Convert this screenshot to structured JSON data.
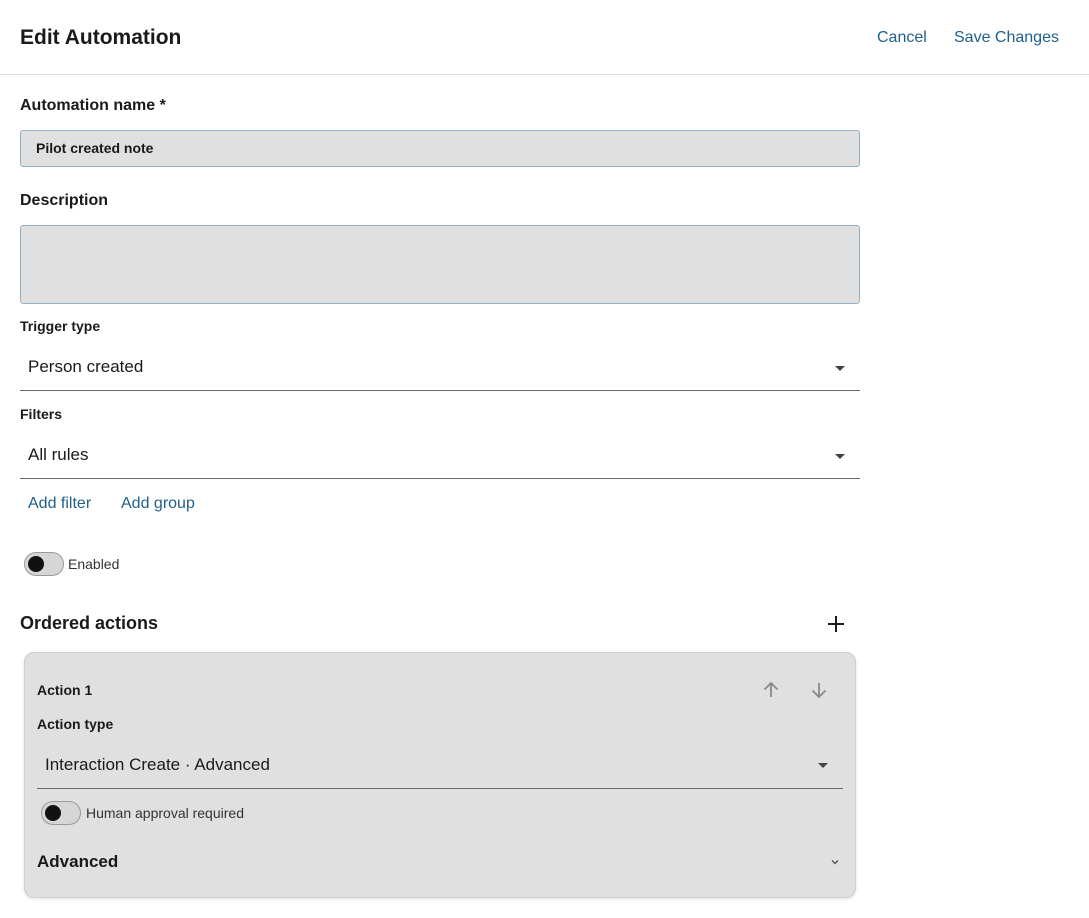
{
  "header": {
    "title": "Edit Automation",
    "cancel_label": "Cancel",
    "save_label": "Save Changes"
  },
  "form": {
    "name_label": "Automation name *",
    "name_value": "Pilot created note",
    "description_label": "Description",
    "description_value": "",
    "trigger_label": "Trigger type",
    "trigger_value": "Person created",
    "filters_label": "Filters",
    "filters_value": "All rules",
    "add_filter_label": "Add filter",
    "add_group_label": "Add group",
    "enabled_label": "Enabled"
  },
  "actions": {
    "section_title": "Ordered actions",
    "items": [
      {
        "title": "Action 1",
        "type_label": "Action type",
        "type_value": "Interaction Create · Advanced",
        "approval_label": "Human approval required",
        "advanced_label": "Advanced"
      }
    ]
  },
  "icons": {
    "plus": "plus-icon",
    "up": "arrow-up-icon",
    "down": "arrow-down-icon",
    "caret": "caret-down-icon",
    "chevron": "chevron-down-icon"
  },
  "colors": {
    "accent": "#1f5f8b",
    "input_bg": "#e0e0e0",
    "input_border": "#8fb4c8"
  }
}
